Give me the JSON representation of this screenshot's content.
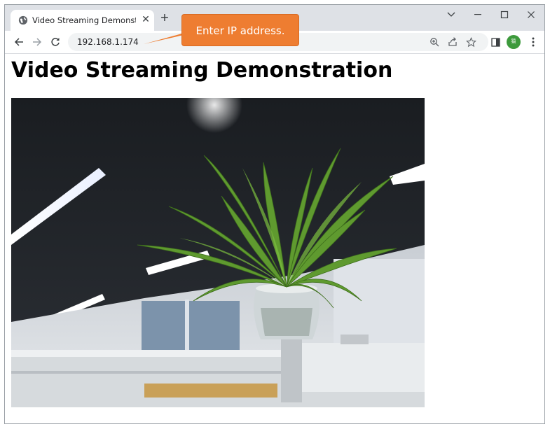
{
  "browser": {
    "tab": {
      "title": "Video Streaming Demonstration",
      "favicon": "globe-icon",
      "close_icon": "close-icon"
    },
    "new_tab_icon": "plus-icon",
    "window_controls": [
      "chevron-down-icon",
      "minimize-icon",
      "maximize-icon",
      "close-icon"
    ],
    "address_bar": {
      "url": "192.168.1.174",
      "icons": [
        "zoom-icon",
        "share-icon",
        "star-icon"
      ]
    },
    "toolbar_icons": [
      "sidebar-icon",
      "profile-avatar",
      "menu-icon"
    ],
    "avatar_text": "猿"
  },
  "annotation": {
    "text": "Enter IP address.",
    "color": "#ee7d31"
  },
  "page": {
    "heading": "Video Streaming Demonstration",
    "video_stream": "camera-stream-image"
  }
}
